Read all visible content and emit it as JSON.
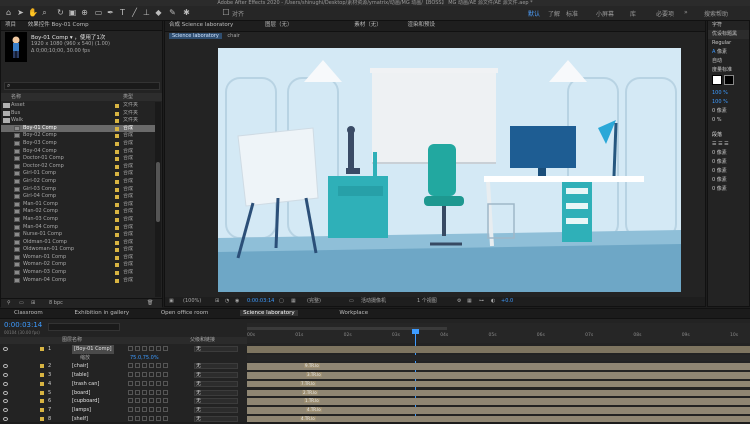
{
  "window": {
    "title": "Adobe After Effects 2020 - /Users/shinughi/Desktop/素材资源/ymatrix/动画/MG 动画/【BOSS】 MG 动画/AE 源文件/AE 源文件.aep *"
  },
  "toolbar": {
    "tools": [
      "home-icon",
      "selection-icon",
      "hand-icon",
      "zoom-icon",
      "rotate-icon",
      "camera-icon",
      "pan-behind-icon",
      "rectangle-icon",
      "pen-icon",
      "text-icon",
      "brush-icon",
      "stamp-icon",
      "eraser-icon",
      "roto-icon",
      "puppet-icon"
    ],
    "align_label": "对齐",
    "workspaces": [
      "默认",
      "了解",
      "标准",
      "小屏幕",
      "库",
      "必要项"
    ],
    "active_workspace": "默认",
    "search_label": "搜索帮助"
  },
  "project": {
    "tabs": [
      "项目",
      "效果控件 Boy-01 Comp"
    ],
    "selected_name": "Boy-01 Comp ▾ ，使用了1次",
    "selected_info1": "1920 x 1080 (960 x 540) (1.00)",
    "selected_info2": "Δ 0;00;10;00, 30.00 fps",
    "search_placeholder": "",
    "col_name": "名称",
    "col_type": "类型",
    "rows": [
      {
        "name": "Asset",
        "type": "文件夹",
        "kind": "folder",
        "indent": 1
      },
      {
        "name": "Bus",
        "type": "文件夹",
        "kind": "folder",
        "indent": 1
      },
      {
        "name": "Walk",
        "type": "文件夹",
        "kind": "folder",
        "indent": 1
      },
      {
        "name": "Boy-01 Comp",
        "type": "合成",
        "kind": "comp",
        "indent": 2,
        "selected": true
      },
      {
        "name": "Boy-02 Comp",
        "type": "合成",
        "kind": "comp",
        "indent": 2
      },
      {
        "name": "Boy-03 Comp",
        "type": "合成",
        "kind": "comp",
        "indent": 2
      },
      {
        "name": "Boy-04 Comp",
        "type": "合成",
        "kind": "comp",
        "indent": 2
      },
      {
        "name": "Doctor-01 Comp",
        "type": "合成",
        "kind": "comp",
        "indent": 2
      },
      {
        "name": "Doctor-02 Comp",
        "type": "合成",
        "kind": "comp",
        "indent": 2
      },
      {
        "name": "Girl-01 Comp",
        "type": "合成",
        "kind": "comp",
        "indent": 2
      },
      {
        "name": "Girl-02 Comp",
        "type": "合成",
        "kind": "comp",
        "indent": 2
      },
      {
        "name": "Girl-03 Comp",
        "type": "合成",
        "kind": "comp",
        "indent": 2
      },
      {
        "name": "Girl-04 Comp",
        "type": "合成",
        "kind": "comp",
        "indent": 2
      },
      {
        "name": "Man-01 Comp",
        "type": "合成",
        "kind": "comp",
        "indent": 2
      },
      {
        "name": "Man-02 Comp",
        "type": "合成",
        "kind": "comp",
        "indent": 2
      },
      {
        "name": "Man-03 Comp",
        "type": "合成",
        "kind": "comp",
        "indent": 2
      },
      {
        "name": "Man-04 Comp",
        "type": "合成",
        "kind": "comp",
        "indent": 2
      },
      {
        "name": "Nurse-01 Comp",
        "type": "合成",
        "kind": "comp",
        "indent": 2
      },
      {
        "name": "Oldman-01 Comp",
        "type": "合成",
        "kind": "comp",
        "indent": 2
      },
      {
        "name": "Oldwoman-01 Comp",
        "type": "合成",
        "kind": "comp",
        "indent": 2
      },
      {
        "name": "Woman-01 Comp",
        "type": "合成",
        "kind": "comp",
        "indent": 2
      },
      {
        "name": "Woman-02 Comp",
        "type": "合成",
        "kind": "comp",
        "indent": 2
      },
      {
        "name": "Woman-03 Comp",
        "type": "合成",
        "kind": "comp",
        "indent": 2
      },
      {
        "name": "Woman-04 Comp",
        "type": "合成",
        "kind": "comp",
        "indent": 2
      }
    ],
    "footer_bpc": "8 bpc"
  },
  "viewer": {
    "tabs": [
      "合成 Science laboratory",
      "图层（无）",
      "素材（无）",
      "渲染和预设"
    ],
    "breadcrumbs": [
      "Science laboratory",
      "chair"
    ],
    "zoom": "(100%)",
    "timecode": "0:00:03:14",
    "quality": "(完整)",
    "camera": "活动摄像机",
    "views": "1 个视图",
    "offset": "+0.0"
  },
  "right_panel": {
    "tabs": [
      "字符",
      "段落"
    ],
    "font_family": "优设标题黑",
    "font_style": "Regular",
    "font_size": "像素",
    "leading": "自动",
    "tracking": "度量标准",
    "scale_v": "100 %",
    "scale_h": "100 %",
    "baseline": "0 像素",
    "tsume": "0 %",
    "paragraph_title": "段落",
    "indent_values": [
      "0 像素",
      "0 像素",
      "0 像素",
      "0 像素",
      "0 像素"
    ]
  },
  "timeline": {
    "tabs": [
      "Classroom",
      "Exhibition in gallery",
      "Open office room",
      "Science laboratory",
      "Workplace"
    ],
    "active_tab": "Science laboratory",
    "timecode": "0:00:03:14",
    "timecode_sub": "00104 (30.00 fps)",
    "col_source": "图层名称",
    "col_parent": "父级和链接",
    "ticks": [
      "00s",
      "01s",
      "02s",
      "03s",
      "04s",
      "05s",
      "06s",
      "07s",
      "08s",
      "09s",
      "10s"
    ],
    "playhead_fraction": 0.348,
    "layers": [
      {
        "num": "1",
        "name": "[Boy-01 Comp]",
        "parent": "无",
        "highlight": true
      },
      {
        "num": "",
        "name": "缩放",
        "parent": "",
        "value": "75.0,75.0%",
        "sub": true
      },
      {
        "num": "2",
        "name": "[chair]",
        "parent": "无",
        "kf": "9.TR.lo"
      },
      {
        "num": "3",
        "name": "[table]",
        "parent": "无",
        "kf": "3.TR.lo"
      },
      {
        "num": "4",
        "name": "[trash can]",
        "parent": "无",
        "kf": "7.TR.lo"
      },
      {
        "num": "5",
        "name": "[board]",
        "parent": "无",
        "kf": "2.TR.lo"
      },
      {
        "num": "6",
        "name": "[cupboard]",
        "parent": "无",
        "kf": "1.TR.lo"
      },
      {
        "num": "7",
        "name": "[lamps]",
        "parent": "无",
        "kf": "4.TR.lo"
      },
      {
        "num": "8",
        "name": "[shelf]",
        "parent": "无",
        "kf": "4.TR.lo"
      }
    ]
  },
  "colors": {
    "accent": "#3d9bff",
    "bar": "#8f8673",
    "canvas_bg": "#cfe6f3",
    "floor": "#6ea7c6"
  }
}
